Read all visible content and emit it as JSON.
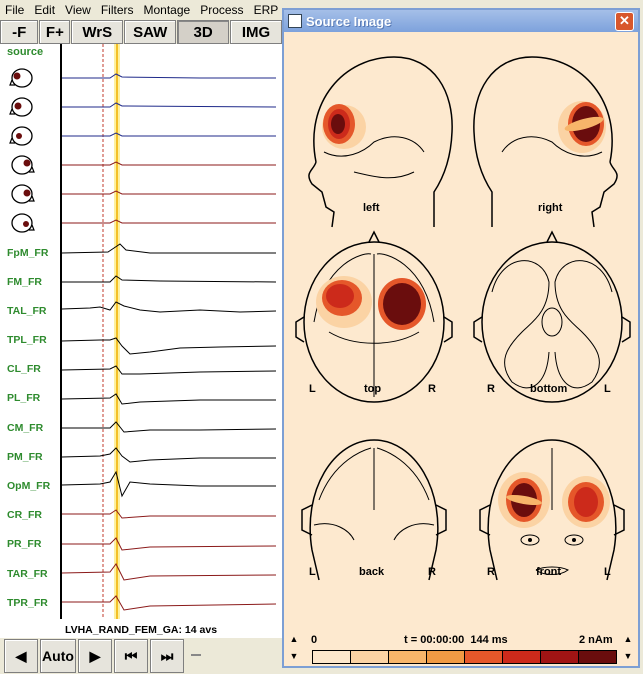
{
  "menu": [
    "File",
    "Edit",
    "View",
    "Filters",
    "Montage",
    "Process",
    "ERP"
  ],
  "toolbar": [
    "-F",
    "F+",
    "WrS",
    "SAW",
    "3D",
    "IMG"
  ],
  "eeg": {
    "source_label": "source",
    "channels": [
      "FpM_FR",
      "FM_FR",
      "TAL_FR",
      "TPL_FR",
      "CL_FR",
      "PL_FR",
      "CM_FR",
      "PM_FR",
      "OpM_FR",
      "CR_FR",
      "PR_FR",
      "TAR_FR",
      "TPR_FR"
    ],
    "footer": "LVHA_RAND_FEM_GA: 14 avs"
  },
  "bottom": {
    "auto_label": "Auto"
  },
  "window": {
    "title": "Source Image",
    "views": {
      "left": "left",
      "right": "right",
      "top": "top",
      "bottom": "bottom",
      "back": "back",
      "front": "front"
    },
    "side_labels": {
      "L": "L",
      "R": "R"
    },
    "colorbar": {
      "min": "0",
      "time": "t = 00:00:00  144 ms",
      "max": "2 nAm"
    }
  },
  "colors": {
    "colorbar": [
      "#fde7cc",
      "#fbd3a4",
      "#f7b56a",
      "#f09a44",
      "#e5572a",
      "#cc2a1b",
      "#a01414",
      "#6a0d0d"
    ],
    "label_green": "#2e8b2e",
    "source_blob_dark": "#6a0d0d"
  }
}
